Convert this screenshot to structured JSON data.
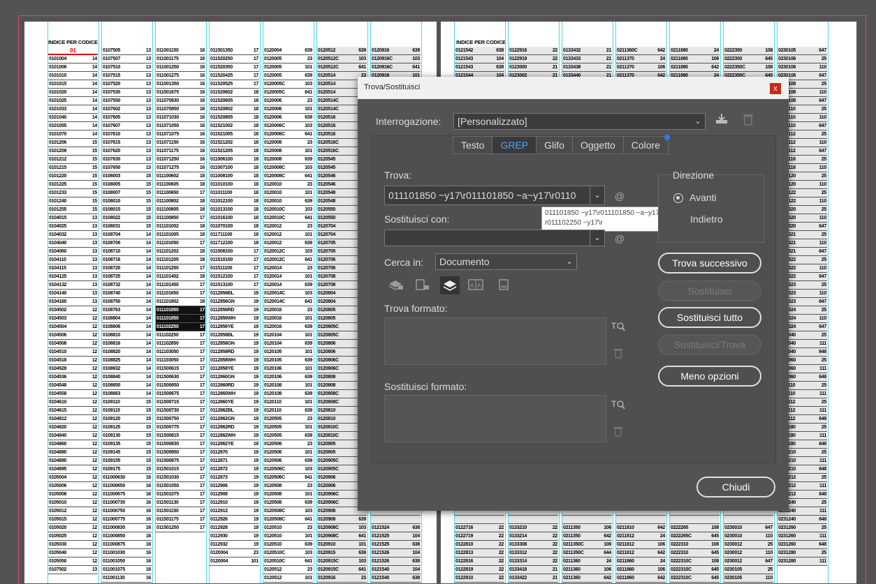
{
  "document": {
    "left_page_title": "INDICE PER CODICE",
    "right_page_title": "INDICE PER CODICE",
    "left_header_code": "01",
    "left_columns": [
      [
        "0101004 14",
        "0101008 14",
        "0101010 14",
        "0101015 14",
        "0101020 14",
        "0101025 14",
        "0101033 14",
        "0101040 14",
        "0101055 14",
        "0101070 14",
        "0101206 15",
        "0101209 15",
        "0101212 15",
        "0101215 15",
        "0101220 15",
        "0101225 15",
        "0101233 15",
        "0101240 15",
        "0101255 15",
        "0104015 13",
        "0104025 13",
        "0104032 13",
        "0104040 13",
        "0104060 13",
        "0104110 13",
        "0104115 13",
        "0104125 13",
        "0104132 13",
        "0104140 13",
        "0104160 13",
        "0104502 12",
        "0104503 12",
        "0104504 12",
        "0104506 12",
        "0104508 12",
        "0104510 12",
        "0104518 12",
        "0104528 12",
        "0104536 12",
        "0104548 12",
        "0104558 12",
        "0104610 12",
        "0104615 12",
        "0104812 12",
        "0104820 12",
        "0104840 12",
        "0104860 12",
        "0104880 12",
        "0104890 12",
        "0104895 12",
        "0105004 12",
        "0105006 12",
        "0105008 12",
        "0105010 12",
        "0105012 12",
        "0105015 12",
        "0105020 12",
        "0105025 12",
        "0105030 12",
        "0105040 12",
        "0105050 12",
        "0107502 13"
      ],
      [
        "0107505 13",
        "0107507 13",
        "0107510 13",
        "0107515 13",
        "0107520 13",
        "0107530 13",
        "0107550 13",
        "0107602 13",
        "0107605 13",
        "0107607 13",
        "0107610 13",
        "0107615 13",
        "0107620 13",
        "0107630 13",
        "0107650 13",
        "0108003 15",
        "0108005 15",
        "0108007 15",
        "0108010 15",
        "0108015 15",
        "0108022 15",
        "0108031 15",
        "0108704 14",
        "0108706 14",
        "0108710 14",
        "0108716 14",
        "0108720 14",
        "0108725 14",
        "0108732 14",
        "0108740 14",
        "0108750 14",
        "0108763 14",
        "0108804 14",
        "0108806 14",
        "0108810 14",
        "0108816 14",
        "0108820 14",
        "0108825 14",
        "0108832 14",
        "0108840 14",
        "0108850 14",
        "0108863 14",
        "0109110 15",
        "0109115 15",
        "0109120 15",
        "0109125 15",
        "0109130 15",
        "0109135 15",
        "0109145 15",
        "0109155 15",
        "0109175 15",
        "011000630 16",
        "011000650 16",
        "011000675 16",
        "011000730 16",
        "011000750 16",
        "011000775 16",
        "011000830 16",
        "011000850 16",
        "011000875 16",
        "011001030 16",
        "011001050 16",
        "011001075 16",
        "011001130 16"
      ],
      [
        "011001150 16",
        "011001175 16",
        "011001250 16",
        "011001275 16",
        "011001350 16",
        "011001675 16",
        "011070830 16",
        "011070850 16",
        "011071030 16",
        "011071050 16",
        "011071075 16",
        "011071150 16",
        "011071175 16",
        "011071250 16",
        "011071275 16",
        "011100602 18",
        "011100605 18",
        "011100650 17",
        "011100802 18",
        "011100805 18",
        "011100850 17",
        "011101002 18",
        "011101005 18",
        "011101050 17",
        "011101202 18",
        "011101205 18",
        "011101250 17",
        "011101402 18",
        "011101450 17",
        "011101650 17",
        "011101802 18",
        "011101850 17",
        "011101850 17",
        "011102250 17",
        "011102250 17",
        "011102850 17",
        "011103050 17",
        "011103050 17",
        "011500615 17",
        "011500630 17",
        "011500650 17",
        "011500675 17",
        "011500715 17",
        "011500730 17",
        "011500750 17",
        "011500775 17",
        "011500815 17",
        "011500830 17",
        "011500850 17",
        "011500875 17",
        "011501015 17",
        "011501030 17",
        "011501050 17",
        "011501075 17",
        "011501130 17",
        "011501150 17",
        "011501175 17",
        "011501250 17"
      ],
      [
        "011501350 17",
        "011520250 17",
        "011520350 17",
        "011520425 17",
        "011520525 17",
        "011520602 18",
        "011520605 18",
        "011520802 18",
        "011520805 18",
        "011521002 18",
        "011521005 18",
        "011521202 18",
        "011521205 18",
        "011006100 18",
        "011007100 18",
        "011008100 18",
        "011010100 18",
        "011011100 18",
        "011012100 18",
        "011013100 18",
        "011016100 18",
        "011070100 18",
        "011711100 18",
        "011712100 18",
        "011508100 17",
        "011510100 17",
        "011511100 17",
        "011512100 17",
        "011513100 17",
        "0112856BL 19",
        "0112856GN 19",
        "0112856RD 19",
        "0112856WH 19",
        "0112856YE 19",
        "0112858BL 19",
        "0112858GN 19",
        "0112858RD 19",
        "0112858WH 19",
        "0112858YE 19",
        "0112860GN 19",
        "0112860RD 19",
        "0112860WH 19",
        "0112860YE 19",
        "0112862BL 19",
        "0112862GN 19",
        "0112862RD 19",
        "0112862WH 19",
        "0112862YE 19",
        "0112870 19",
        "0112871 19",
        "0112872 19",
        "0112873 19",
        "0112906 19",
        "0112908 19",
        "0112910 19",
        "0112912 19",
        "0112926 19",
        "0112928 19",
        "0112930 19",
        "0112932 19",
        "0120004 23",
        "0120004 101"
      ],
      [
        "0120004 639",
        "0120005 23",
        "0120005 101",
        "0120005 639",
        "0120005C 103",
        "0120005C 641",
        "0120006 23",
        "0120006 101",
        "0120006 639",
        "0120006C 103",
        "0120006C 641",
        "0120008 23",
        "0120008 101",
        "0120008 639",
        "0120008C 103",
        "0120008C 641",
        "0120010 23",
        "0120010 101",
        "0120010 639",
        "0120010C 103",
        "0120010C 641",
        "0120012 23",
        "0120012 101",
        "0120012 639",
        "0120012C 103",
        "0120012C 641",
        "0120014 23",
        "0120014 101",
        "0120014 639",
        "0120014C 103",
        "0120014C 641",
        "0120016 23",
        "0120016 101",
        "0120016 639",
        "0120104 101",
        "0120104 639",
        "0120105 101",
        "0120105 639",
        "0120106 101",
        "0120106 639",
        "0120108 101",
        "0120108 639",
        "0120110 101",
        "0120110 639",
        "0120505 23",
        "0120505 101",
        "0120505 639",
        "0120506 23",
        "0120506 101",
        "0120506 639",
        "0120506C 103",
        "0120506C 641",
        "0120508 23",
        "0120508 101",
        "0120508 639",
        "0120508C 103",
        "0120508C 641",
        "0120510 23",
        "0120510 101",
        "0120510 639",
        "0120510C 103",
        "0120510C 641",
        "0120512 23",
        "0120512 101"
      ],
      [
        "0120512 639",
        "0120512C 103",
        "0120512C 641",
        "0120514 23",
        "0120514",
        "0120514",
        "0120514C",
        "0120514C",
        "0120516",
        "0120516",
        "0120516",
        "0120516C",
        "0120516C",
        "0120545",
        "0120545",
        "0120546",
        "0120546",
        "0120548",
        "0120548",
        "0120550",
        "0120550",
        "0120704",
        "0120704",
        "0120705",
        "0120705",
        "0120706",
        "0120706",
        "0120708",
        "0120708",
        "0120804",
        "0120804",
        "0120805",
        "0120805",
        "0120805C",
        "0120805C",
        "0120806",
        "0120806",
        "0120806C",
        "0120806C",
        "0120808",
        "0120808",
        "0120808C",
        "0120808C",
        "0120810",
        "0120810",
        "0120810C",
        "0120810C",
        "0120905",
        "0120905",
        "0120905C",
        "0120905C",
        "0120906",
        "0120906",
        "0120906C",
        "0120906C",
        "0120908",
        "0120908 639",
        "0120908C 103",
        "0120908C 641",
        "0120910 101",
        "0120915 639",
        "0120915C 103",
        "0120915C 641",
        "0120916 23"
      ],
      [
        "0120916 639",
        "0120916C 103",
        "0120916C 641",
        "0120918 101",
        "",
        "",
        "",
        "",
        "",
        "",
        "",
        "",
        "",
        "",
        "",
        "",
        "",
        "",
        "",
        "",
        "",
        "",
        "",
        "",
        "",
        "",
        "",
        "",
        "",
        "",
        "",
        "",
        "",
        "",
        "",
        "",
        "",
        "",
        "",
        "",
        "",
        "",
        "",
        "",
        "",
        "",
        "",
        "",
        "",
        "",
        "",
        "",
        "",
        "",
        "",
        "",
        "",
        "0121524 638",
        "0121525 104",
        "0121525 638",
        "0121526 104",
        "0121526 638",
        "0121540 104",
        "0121540 638",
        "0121542 104"
      ]
    ],
    "right_columns": [
      [
        "0121542 638",
        "0121543 104",
        "0121543 638",
        "0121544 104",
        "",
        "",
        "",
        "",
        "",
        "",
        "",
        "",
        "",
        "",
        "",
        "",
        "",
        "",
        "",
        "",
        "",
        "",
        "",
        "",
        "",
        "",
        "",
        "",
        "",
        "",
        "",
        "",
        "",
        "",
        "",
        "",
        "",
        "",
        "",
        "",
        "",
        "",
        "",
        "",
        "",
        "",
        "",
        "",
        "",
        "",
        "",
        "",
        "",
        "",
        "",
        "",
        "",
        "0122716 22",
        "0122719 22",
        "0122810 22",
        "0122813 22",
        "0122816 22",
        "0122819 22",
        "0122910 22",
        "0122913 22"
      ],
      [
        "0122916 22",
        "0122919 22",
        "0123000 21",
        "0123002 21",
        "",
        "",
        "",
        "",
        "",
        "",
        "",
        "",
        "",
        "",
        "",
        "",
        "",
        "",
        "",
        "",
        "",
        "",
        "",
        "",
        "",
        "",
        "",
        "",
        "",
        "",
        "",
        "",
        "",
        "",
        "",
        "",
        "",
        "",
        "",
        "",
        "",
        "",
        "",
        "",
        "",
        "",
        "",
        "",
        "",
        "",
        "",
        "",
        "",
        "",
        "",
        "",
        "",
        "0133210 22",
        "0133214 22",
        "0133308 22",
        "0133312 22",
        "0133314 22",
        "0133418 21",
        "0133422 21",
        "0133426 21"
      ],
      [
        "0133432 21",
        "0133433 21",
        "0133438 21",
        "0133440 21",
        "",
        "",
        "",
        "",
        "",
        "",
        "",
        "",
        "",
        "",
        "",
        "",
        "",
        "",
        "",
        "",
        "",
        "",
        "",
        "",
        "",
        "",
        "",
        "",
        "",
        "",
        "",
        "",
        "",
        "",
        "",
        "",
        "",
        "",
        "",
        "",
        "",
        "",
        "",
        "",
        "",
        "",
        "",
        "",
        "",
        "",
        "",
        "",
        "",
        "",
        "",
        "",
        "",
        "0211350 106",
        "0211350 642",
        "0211350C 108",
        "0211350C 644",
        "0211360 24",
        "0211360 106",
        "0211360 642",
        "0211360C 108"
      ],
      [
        "0211360C 642",
        "0211370 24",
        "0211370 106",
        "0211370 642",
        "",
        "",
        "",
        "",
        "",
        "",
        "",
        "",
        "",
        "",
        "",
        "",
        "",
        "",
        "",
        "",
        "",
        "",
        "",
        "",
        "",
        "",
        "",
        "",
        "",
        "",
        "",
        "",
        "",
        "",
        "",
        "",
        "",
        "",
        "",
        "",
        "",
        "",
        "",
        "",
        "",
        "",
        "",
        "",
        "",
        "",
        "",
        "",
        "",
        "",
        "",
        "",
        "",
        "0211810 642",
        "0211812 24",
        "0211812 106",
        "0211812 642",
        "0211860 24",
        "0211860 106",
        "0211860 642",
        "0211860 642"
      ],
      [
        "0211880 24",
        "0211880 106",
        "0211880 642",
        "0211890 24",
        "",
        "",
        "",
        "",
        "",
        "",
        "",
        "",
        "",
        "",
        "",
        "",
        "",
        "",
        "",
        "",
        "",
        "",
        "",
        "",
        "",
        "",
        "",
        "",
        "",
        "",
        "",
        "",
        "",
        "",
        "",
        "",
        "",
        "",
        "",
        "",
        "",
        "",
        "",
        "",
        "",
        "",
        "",
        "",
        "",
        "",
        "",
        "",
        "",
        "",
        "",
        "",
        "",
        "0222265 108",
        "0222265C 645",
        "0222310 108",
        "0222310 645",
        "0222310C 108",
        "0222310C 645",
        "0222310C 645",
        "0222310C 645"
      ],
      [
        "0222350 108",
        "0222350 645",
        "0222350C 108",
        "0222350C 645",
        "",
        "",
        "",
        "",
        "",
        "",
        "",
        "",
        "",
        "",
        "",
        "",
        "",
        "",
        "",
        "",
        "",
        "",
        "",
        "",
        "",
        "",
        "",
        "",
        "",
        "",
        "",
        "",
        "",
        "",
        "",
        "",
        "",
        "",
        "",
        "",
        "",
        "",
        "",
        "",
        "",
        "",
        "",
        "",
        "",
        "",
        "",
        "",
        "",
        "",
        "",
        "",
        "",
        "0230010 647",
        "0230010 110",
        "0230012 25",
        "0230012 110",
        "0230012 647",
        "0230105 25",
        "0230105 110",
        "0230105 110"
      ],
      [
        "0230105 647",
        "0230106 25",
        "0230106 110",
        "0230106 647",
        "0230108 25",
        "0230108 110",
        "0230108 647",
        "0230110 25",
        "0230110 110",
        "0230110 647",
        "0230112 25",
        "0230112 110",
        "0230112 647",
        "0230118 25",
        "0230118 110",
        "0230120 25",
        "0230120 110",
        "0230122 25",
        "0230122 110",
        "0230320 25",
        "0230320 110",
        "0230320 647",
        "0230321 25",
        "0230321 110",
        "0230321 647",
        "0230322 25",
        "0230322 110",
        "0230322 647",
        "0230323 25",
        "0230323 110",
        "0230323 647",
        "0230324 25",
        "0230324 110",
        "0230324 647",
        "0231040 25",
        "0231040 111",
        "0231040 648",
        "0231060 25",
        "0231060 111",
        "0231060 648",
        "0231110 25",
        "0231110 111",
        "0231112 25",
        "0231112 111",
        "0231112 648",
        "0231180 25",
        "0231180 111",
        "0231180 648",
        "0231210 25",
        "0231210 111",
        "0231210 648",
        "0231212 25",
        "0231212 111",
        "0231212 648",
        "0231240 25",
        "0231240 111",
        "0231240 648",
        "0231260 25",
        "0231260 111",
        "0231260 648",
        "0231280 25",
        "0231280 111"
      ]
    ]
  },
  "dialog": {
    "title": "Trova/Sostituisci",
    "close_glyph": "x",
    "query_label": "Interrogazione:",
    "query_value": "[Personalizzato]",
    "tabs": [
      "Testo",
      "GREP",
      "Glifo",
      "Oggetto",
      "Colore"
    ],
    "active_tab": "GREP",
    "find_label": "Trova:",
    "find_value": "011101850  ~y17\\r011101850  ~a~y17\\r0110",
    "tooltip_line1": "011101850  ~y17\\r011101850  ~a~y17\\",
    "tooltip_line2": "r011102250  ~y17\\r",
    "replace_label": "Sostituisci con:",
    "replace_value": "",
    "direction_label": "Direzione",
    "direction_forward": "Avanti",
    "direction_back": "Indietro",
    "search_in_label": "Cerca in:",
    "search_in_value": "Documento",
    "find_format_label": "Trova formato:",
    "replace_format_label": "Sostituisci formato:",
    "buttons": {
      "find_next": "Trova successivo",
      "replace": "Sostituisci",
      "replace_all": "Sostituisci tutto",
      "replace_find": "Sostituisci/Trova",
      "fewer_options": "Meno opzioni",
      "close": "Chiudi"
    },
    "icon_at": "@",
    "accent_color": "#4aa3ff"
  }
}
